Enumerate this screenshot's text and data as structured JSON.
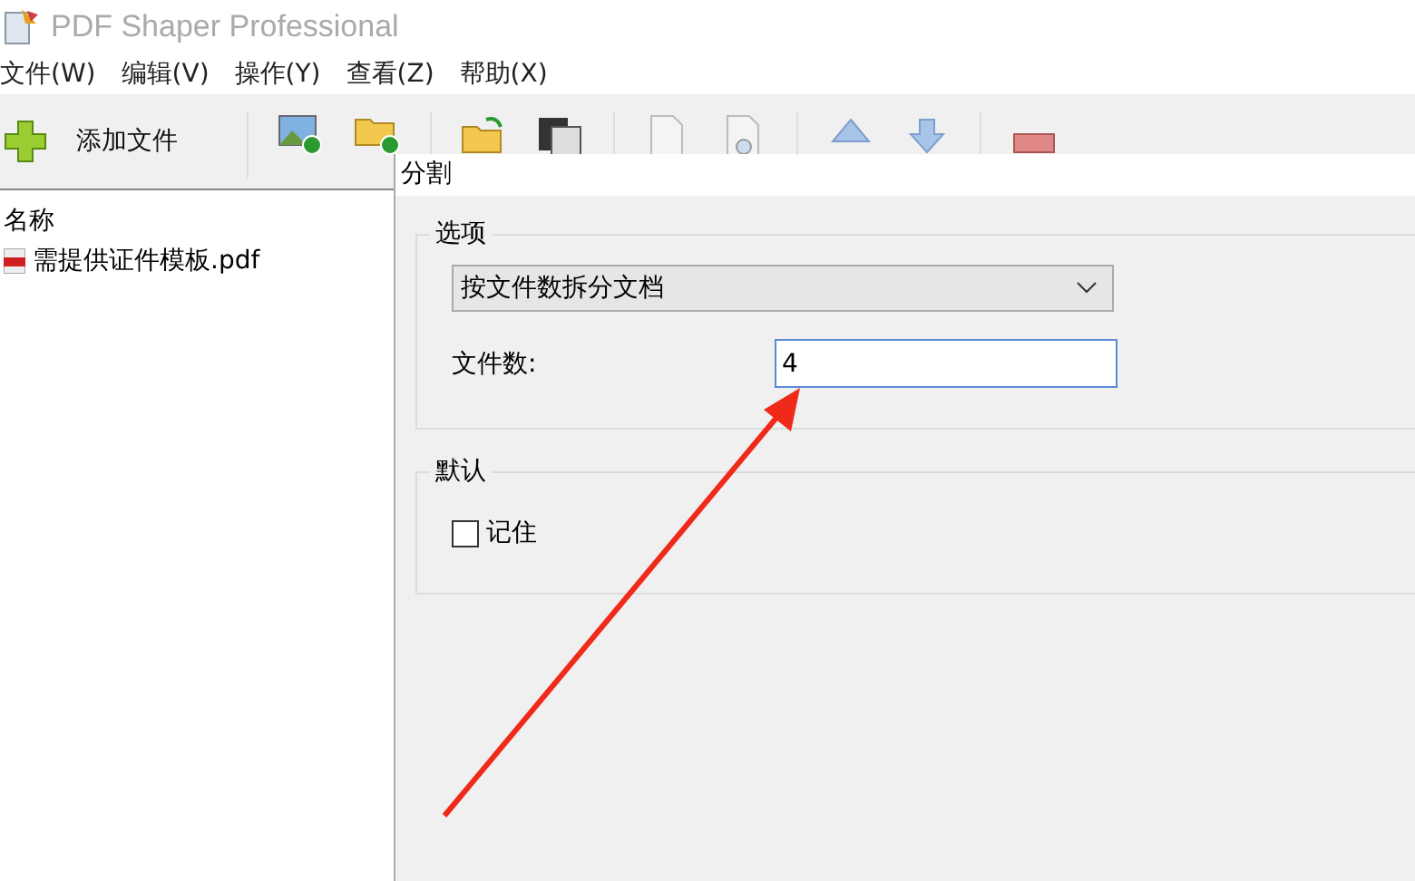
{
  "window": {
    "title": "PDF Shaper Professional"
  },
  "menu": [
    "文件(W)",
    "编辑(V)",
    "操作(Y)",
    "查看(Z)",
    "帮助(X)"
  ],
  "toolbar": {
    "add_file": "添加文件"
  },
  "file_list": {
    "header": "名称",
    "files": [
      "需提供证件模板.pdf"
    ]
  },
  "dialog": {
    "title": "分割",
    "options_group": "选项",
    "mode": "按文件数拆分文档",
    "count_label": "文件数:",
    "count_value": "4",
    "default_group": "默认",
    "remember": {
      "label": "记住",
      "checked": false
    }
  }
}
